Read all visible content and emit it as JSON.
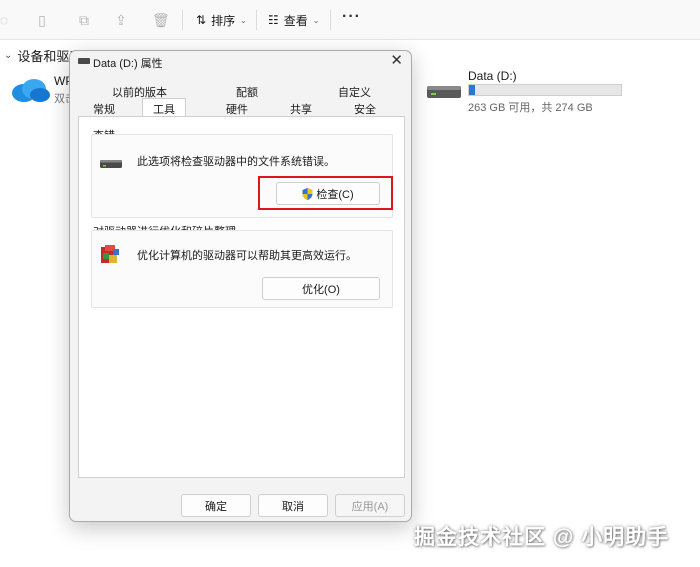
{
  "toolbar": {
    "sort_label": "排序",
    "view_label": "查看",
    "more_label": "···"
  },
  "explorer": {
    "section_header": "设备和驱动器",
    "onedrive": {
      "name": "WPS",
      "sub": "双击"
    },
    "drive_d": {
      "name": "Data (D:)",
      "free_text": "263 GB 可用，共 274 GB",
      "used_fraction": 0.04
    }
  },
  "dialog": {
    "title": "Data (D:) 属性",
    "tabs_row1": [
      "以前的版本",
      "配额",
      "自定义"
    ],
    "tabs_row2": [
      "常规",
      "工具",
      "硬件",
      "共享",
      "安全"
    ],
    "active_tab": "工具",
    "check_group": {
      "label": "查错",
      "description": "此选项将检查驱动器中的文件系统错误。",
      "button": "检查(C)"
    },
    "optimize_group": {
      "label": "对驱动器进行优化和碎片整理",
      "description": "优化计算机的驱动器可以帮助其更高效运行。",
      "button": "优化(O)"
    },
    "footer": {
      "ok": "确定",
      "cancel": "取消",
      "apply": "应用(A)"
    }
  },
  "watermark": "掘金技术社区 @ 小明助手",
  "colors": {
    "accent": "#2b77d6",
    "highlight": "#e0151c"
  }
}
